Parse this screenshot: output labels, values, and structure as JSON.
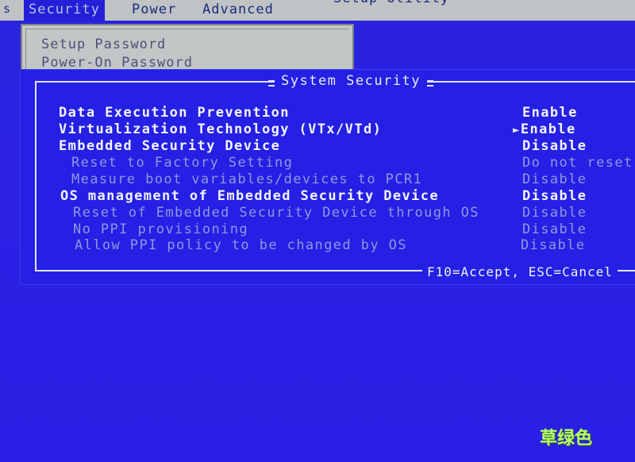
{
  "menubar": {
    "stub": "s",
    "tabs": [
      {
        "label": "Security",
        "active": true
      },
      {
        "label": "Power",
        "active": false
      },
      {
        "label": "Advanced",
        "active": false
      }
    ],
    "title": "Setup Utility"
  },
  "left_panel": {
    "items": [
      "Setup Password",
      "Power-On Password"
    ]
  },
  "dialog": {
    "title": "System Security",
    "footer": "F10=Accept, ESC=Cancel",
    "rows": [
      {
        "label": "Data Execution Prevention",
        "value": "Enable",
        "enabled": true,
        "selected": false
      },
      {
        "label": "Virtualization Technology (VTx/VTd)",
        "value": "Enable",
        "enabled": true,
        "selected": true
      },
      {
        "label": "Embedded Security Device",
        "value": "Disable",
        "enabled": true,
        "selected": false
      },
      {
        "label": "Reset to Factory Setting",
        "value": "Do not reset",
        "enabled": false,
        "selected": false
      },
      {
        "label": "Measure boot variables/devices to PCR1",
        "value": "Disable",
        "enabled": false,
        "selected": false
      },
      {
        "label": "OS management of Embedded Security Device",
        "value": "Disable",
        "enabled": true,
        "selected": false
      },
      {
        "label": "Reset of Embedded Security Device through OS",
        "value": "Disable",
        "enabled": false,
        "selected": false
      },
      {
        "label": "No PPI provisioning",
        "value": "Disable",
        "enabled": false,
        "selected": false
      },
      {
        "label": "Allow PPI policy to be changed by OS",
        "value": "Disable",
        "enabled": false,
        "selected": false
      }
    ],
    "selected_marker": "►"
  },
  "watermark": "草绿色",
  "colors": {
    "background": "#2a22e0",
    "menubar": "#bfc3c6",
    "active_tab": "#2320d8",
    "text_bright": "#f2f5fc",
    "text_dim": "#8e98e2",
    "watermark": "#b6ff6e"
  }
}
